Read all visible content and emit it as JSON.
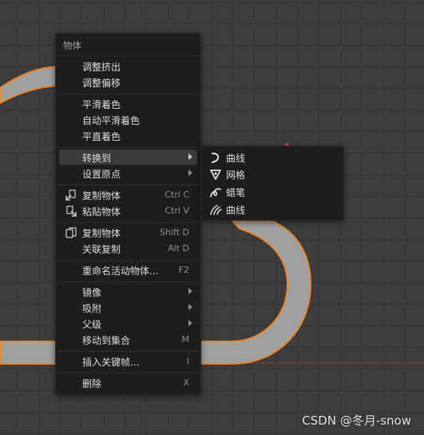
{
  "context_menu": {
    "title": "物体",
    "items": [
      {
        "label": "调整挤出"
      },
      {
        "label": "调整偏移"
      },
      {
        "label": "平滑着色"
      },
      {
        "label": "自动平滑着色"
      },
      {
        "label": "平直着色"
      },
      {
        "label": "转换到",
        "submenu": true,
        "highlighted": true
      },
      {
        "label": "设置原点",
        "submenu": true
      },
      {
        "label": "复制物体",
        "shortcut": "Ctrl C",
        "icon": "copy-object-icon"
      },
      {
        "label": "粘贴物体",
        "shortcut": "Ctrl V",
        "icon": "paste-object-icon"
      },
      {
        "label": "复制物体",
        "shortcut": "Shift D",
        "icon": "duplicate-objects-icon"
      },
      {
        "label": "关联复制",
        "shortcut": "Alt D"
      },
      {
        "label": "重命名活动物体...",
        "shortcut": "F2"
      },
      {
        "label": "镜像",
        "submenu": true
      },
      {
        "label": "吸附",
        "submenu": true
      },
      {
        "label": "父级",
        "submenu": true
      },
      {
        "label": "移动到集合",
        "shortcut": "M"
      },
      {
        "label": "插入关键帧...",
        "shortcut": "I"
      },
      {
        "label": "删除",
        "shortcut": "X"
      }
    ]
  },
  "convert_submenu": {
    "items": [
      {
        "label": "曲线",
        "icon": "curve-icon"
      },
      {
        "label": "网格",
        "icon": "mesh-icon"
      },
      {
        "label": "蜡笔",
        "icon": "grease-pencil-icon"
      },
      {
        "label": "曲线",
        "icon": "curves-hair-icon"
      }
    ]
  },
  "watermark": "CSDN @冬月-snow",
  "colors": {
    "viewport_bg": "#3d3d3d",
    "grid_line": "#333333",
    "menu_bg": "#1d1d1d",
    "menu_highlight": "#3b3b3b",
    "object_fill": "#a0a0a0",
    "selection_outline": "#e8862a",
    "annotation_arrow": "#e53935",
    "x_axis": "#8a3a3a"
  }
}
